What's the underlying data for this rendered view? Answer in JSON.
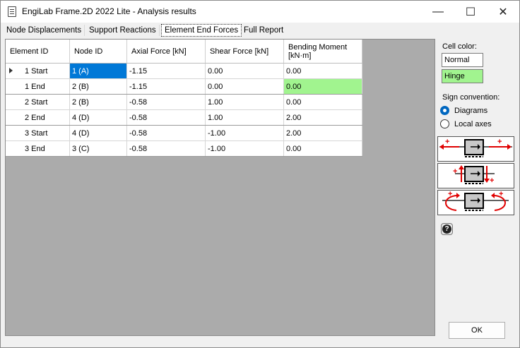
{
  "window": {
    "title": "EngiLab Frame.2D 2022 Lite - Analysis results",
    "minimize": "—",
    "maximize": "☐",
    "close": "✕"
  },
  "tabs": [
    "Node Displacements",
    "Support Reactions",
    "Element End Forces",
    "Full Report"
  ],
  "active_tab": "Element End Forces",
  "table": {
    "headers": [
      "Element ID",
      "Node ID",
      "Axial Force [kN]",
      "Shear Force [kN]",
      "Bending Moment",
      "[kN·m]"
    ],
    "rows": [
      [
        "1 Start",
        "1 (A)",
        "-1.15",
        "0.00",
        "0.00"
      ],
      [
        "1 End",
        "2 (B)",
        "-1.15",
        "0.00",
        "0.00"
      ],
      [
        "2 Start",
        "2 (B)",
        "-0.58",
        "1.00",
        "0.00"
      ],
      [
        "2 End",
        "4 (D)",
        "-0.58",
        "1.00",
        "2.00"
      ],
      [
        "3 Start",
        "4 (D)",
        "-0.58",
        "-1.00",
        "2.00"
      ],
      [
        "3 End",
        "3 (C)",
        "-0.58",
        "-1.00",
        "0.00"
      ]
    ],
    "selected_cell": "1 (A)",
    "hinge_color": "#a1f48f",
    "selection_color": "#0078d7"
  },
  "side": {
    "cell_color_label": "Cell color:",
    "normal_label": "Normal",
    "hinge_label": "Hinge",
    "sign_convention_label": "Sign convention:",
    "options": [
      "Diagrams",
      "Local axes"
    ],
    "selected_option": "Diagrams",
    "plus": "+",
    "help": "?"
  },
  "ok_label": "OK"
}
